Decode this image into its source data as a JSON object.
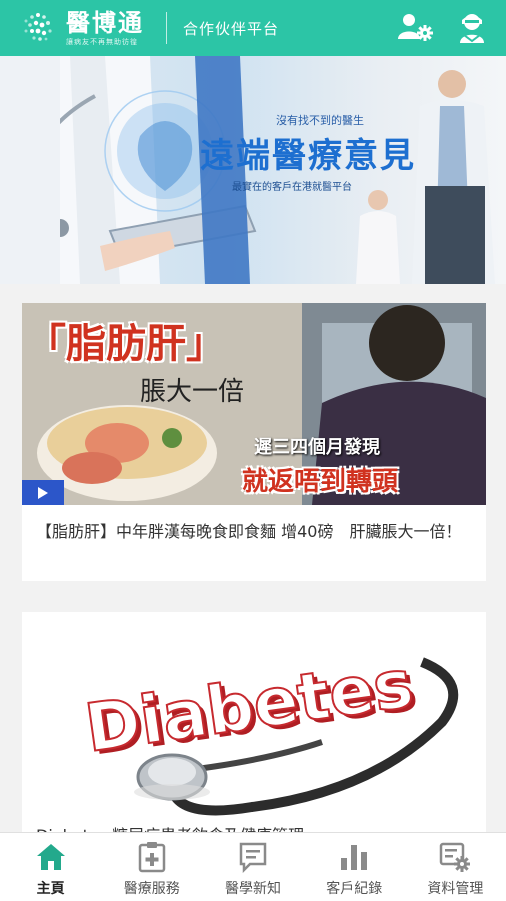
{
  "header": {
    "logo_name": "醫博通",
    "logo_slogan": "讓病友不再無助彷徨",
    "partner_title": "合作伙伴平台"
  },
  "banner": {
    "small_text": "沒有找不到的醫生",
    "title": "遠端醫療意見",
    "subtitle": "最實在的客戶在港就醫平台"
  },
  "articles": [
    {
      "overlay_top": "「脂肪肝」",
      "overlay_sub": "脹大一倍",
      "overlay_small": "遲三四個月發現",
      "overlay_big": "就返唔到轉頭",
      "title": "【脂肪肝】中年胖漢每晚食即食麵 增40磅　肝臟脹大一倍！"
    },
    {
      "image_word": "Diabetes",
      "caption": "Diabetes 糖尿病患者飲食及健康管理"
    }
  ],
  "nav": {
    "items": [
      {
        "label": "主頁"
      },
      {
        "label": "醫療服務"
      },
      {
        "label": "醫學新知"
      },
      {
        "label": "客戶紀錄"
      },
      {
        "label": "資料管理"
      }
    ]
  },
  "colors": {
    "brand": "#2cc5a6",
    "active_nav": "#23a98c"
  }
}
